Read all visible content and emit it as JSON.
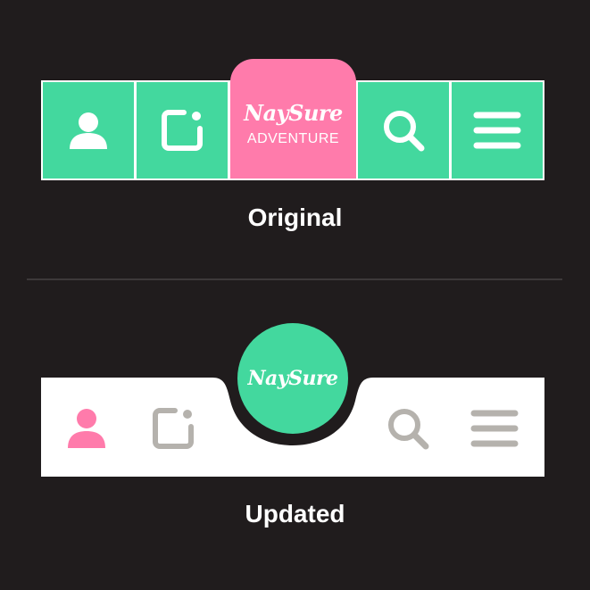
{
  "original": {
    "brand": {
      "script": "NaySure",
      "subtitle": "ADVENTURE"
    },
    "label": "Original",
    "nav": [
      {
        "icon": "user-icon"
      },
      {
        "icon": "note-icon"
      },
      {
        "icon": "search-icon"
      },
      {
        "icon": "menu-icon"
      }
    ],
    "colors": {
      "cell": "#43d89e",
      "logo_tab": "#ff7bab",
      "icon": "#ffffff"
    }
  },
  "updated": {
    "brand": {
      "script": "NaySure"
    },
    "label": "Updated",
    "nav": [
      {
        "icon": "user-icon",
        "active": true
      },
      {
        "icon": "note-icon",
        "active": false
      },
      {
        "icon": "search-icon",
        "active": false
      },
      {
        "icon": "menu-icon",
        "active": false
      }
    ],
    "colors": {
      "bar": "#ffffff",
      "logo_circle": "#43d89e",
      "active_icon": "#ff7bab",
      "inactive_icon": "#b5b2ad"
    }
  }
}
